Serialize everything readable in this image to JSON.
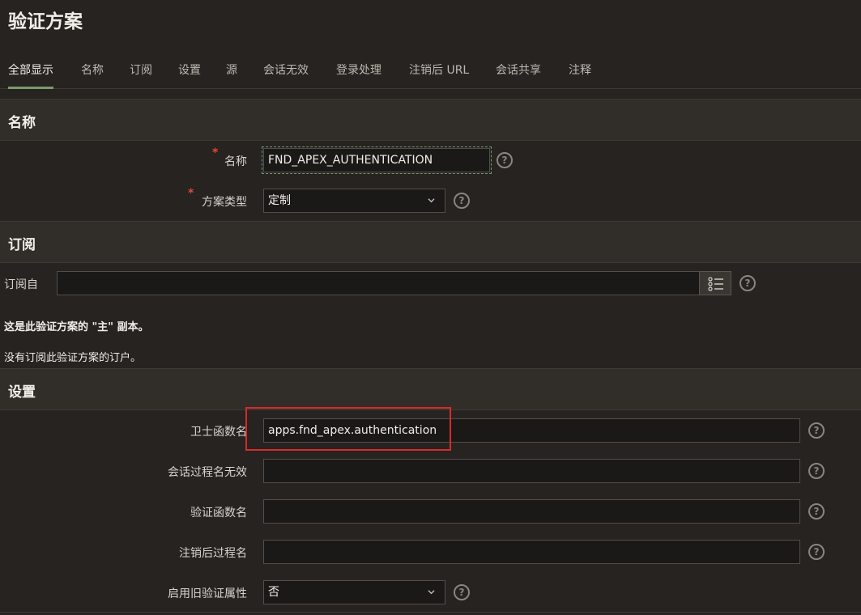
{
  "page": {
    "title": "验证方案"
  },
  "tabs": [
    {
      "label": "全部显示"
    },
    {
      "label": "名称"
    },
    {
      "label": "订阅"
    },
    {
      "label": "设置"
    },
    {
      "label": "源"
    },
    {
      "label": "会话无效"
    },
    {
      "label": "登录处理"
    },
    {
      "label": "注销后 URL"
    },
    {
      "label": "会话共享"
    },
    {
      "label": "注释"
    }
  ],
  "sections": {
    "name": {
      "title": "名称",
      "name_label": "名称",
      "name_value": "FND_APEX_AUTHENTICATION",
      "scheme_type_label": "方案类型",
      "scheme_type_value": "定制"
    },
    "subscription": {
      "title": "订阅",
      "subscribe_from_label": "订阅自",
      "subscribe_from_value": "",
      "master_copy_text": "这是此验证方案的 \"主\" 副本。",
      "no_subscribers_text": "没有订阅此验证方案的订户。"
    },
    "settings": {
      "title": "设置",
      "sentry_function_label": "卫士函数名",
      "sentry_function_value": "apps.fnd_apex.authentication",
      "invalid_session_label": "会话过程名无效",
      "invalid_session_value": "",
      "auth_function_label": "验证函数名",
      "auth_function_value": "",
      "post_logout_label": "注销后过程名",
      "post_logout_value": "",
      "legacy_attr_label": "启用旧验证属性",
      "legacy_attr_value": "否"
    }
  },
  "help_glyph": "?",
  "colors": {
    "background": "#262320",
    "section_header": "#312e2a",
    "active_tab_underline": "#7a9a6a",
    "required_star": "#e0483b",
    "highlight": "#d62b2b"
  }
}
